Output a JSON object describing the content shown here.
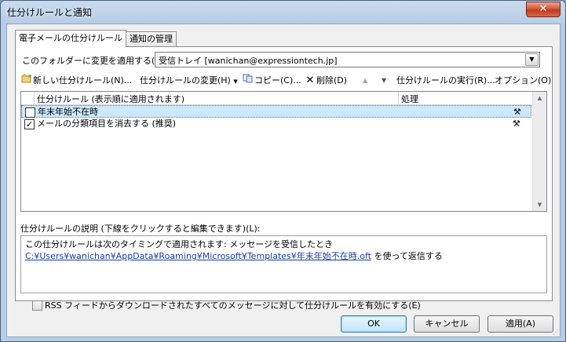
{
  "window": {
    "title": "仕分けルールと通知",
    "close_glyph": "✕"
  },
  "tabs": [
    {
      "label": "電子メールの仕分けルール",
      "active": true
    },
    {
      "label": "通知の管理",
      "active": false
    }
  ],
  "folder": {
    "label": "このフォルダーに変更を適用する(F):",
    "value": "受信トレイ [wanichan@expressiontech.jp]"
  },
  "toolbar": {
    "new_rule": "新しい仕分けルール(N)...",
    "change_rule": "仕分けルールの変更(H)",
    "copy": "コピー(C)...",
    "delete": "削除(D)",
    "move_up_icon": "▲",
    "move_down_icon": "▼",
    "run_rules": "仕分けルールの実行(R)...",
    "options": "オプション(O)"
  },
  "rules_list": {
    "col_rule": "仕分けルール (表示順に適用されます)",
    "col_action": "処理",
    "rows": [
      {
        "name": "年末年始不在時",
        "checked": false,
        "selected": true
      },
      {
        "name": "メールの分類項目を消去する (推奨)",
        "checked": true,
        "selected": false
      }
    ]
  },
  "description": {
    "label": "仕分けルールの説明 (下線をクリックすると編集できます)(L):",
    "line1": "この仕分けルールは次のタイミングで適用されます: メッセージを受信したとき",
    "link": "C:¥Users¥wanichan¥AppData¥Roaming¥Microsoft¥Templates¥年末年始不在時.oft",
    "line2_suffix": " を使って返信する"
  },
  "rss_option": {
    "label": "RSS フィードからダウンロードされたすべてのメッセージに対して仕分けルールを有効にする(E)",
    "checked": false
  },
  "buttons": {
    "ok": "OK",
    "cancel": "キャンセル",
    "apply": "適用(A)"
  }
}
